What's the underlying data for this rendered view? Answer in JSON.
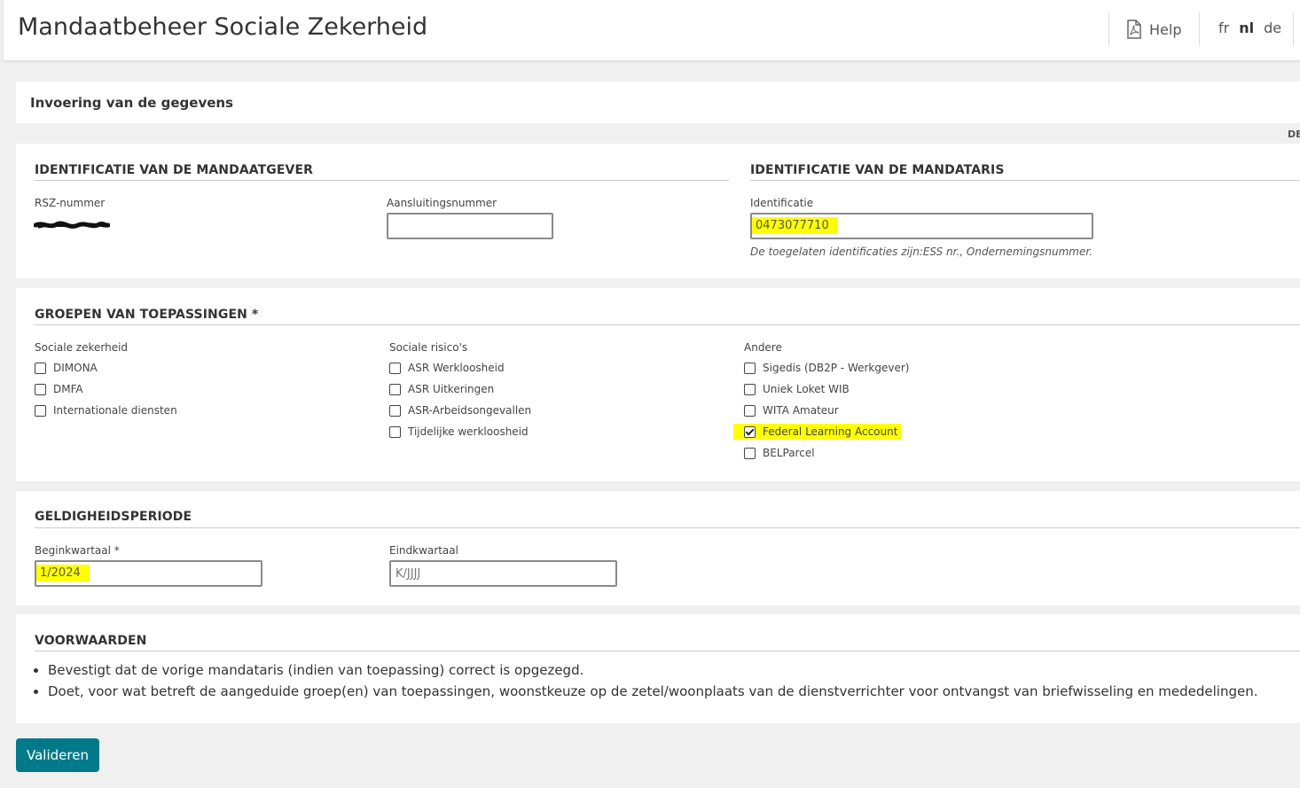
{
  "header": {
    "title": "Mandaatbeheer Sociale Zekerheid",
    "help_label": "Help",
    "languages": [
      "fr",
      "nl",
      "de"
    ],
    "active_language": "nl"
  },
  "step": {
    "title": "Invoering van de gegevens",
    "corner_text": "DE"
  },
  "mandaatgever": {
    "title": "IDENTIFICATIE VAN DE MANDAATGEVER",
    "rsz_label": "RSZ-nummer",
    "aansluiting_label": "Aansluitingsnummer",
    "aansluiting_value": ""
  },
  "mandataris": {
    "title": "IDENTIFICATIE VAN DE MANDATARIS",
    "identificatie_label": "Identificatie",
    "identificatie_value": "0473077710",
    "hint": "De toegelaten identificaties zijn:ESS nr., Ondernemingsnummer."
  },
  "groups": {
    "title": "GROEPEN VAN TOEPASSINGEN *",
    "columns": [
      {
        "label": "Sociale zekerheid",
        "items": [
          {
            "label": "DIMONA",
            "checked": false
          },
          {
            "label": "DMFA",
            "checked": false
          },
          {
            "label": "Internationale diensten",
            "checked": false
          }
        ]
      },
      {
        "label": "Sociale risico's",
        "items": [
          {
            "label": "ASR Werkloosheid",
            "checked": false
          },
          {
            "label": "ASR Uitkeringen",
            "checked": false
          },
          {
            "label": "ASR-Arbeidsongevallen",
            "checked": false
          },
          {
            "label": "Tijdelijke werkloosheid",
            "checked": false
          }
        ]
      },
      {
        "label": "Andere",
        "items": [
          {
            "label": "Sigedis (DB2P - Werkgever)",
            "checked": false
          },
          {
            "label": "Uniek Loket WIB",
            "checked": false
          },
          {
            "label": "WITA Amateur",
            "checked": false
          },
          {
            "label": "Federal Learning Account",
            "checked": true
          },
          {
            "label": "BELParcel",
            "checked": false
          }
        ]
      }
    ]
  },
  "period": {
    "title": "GELDIGHEIDSPERIODE",
    "begin_label": "Beginkwartaal *",
    "begin_value": "1/2024",
    "end_label": "Eindkwartaal",
    "end_placeholder": "K/JJJJ"
  },
  "conditions": {
    "title": "VOORWAARDEN",
    "items": [
      "Bevestigt dat de vorige mandataris (indien van toepassing) correct is opgezegd.",
      "Doet, voor wat betreft de aangeduide groep(en) van toepassingen, woonstkeuze op de zetel/woonplaats van de dienstverrichter voor ontvangst van briefwisseling en mededelingen."
    ]
  },
  "actions": {
    "validate_label": "Valideren"
  },
  "colors": {
    "accent": "#007a8a",
    "highlight": "#ffff00"
  }
}
